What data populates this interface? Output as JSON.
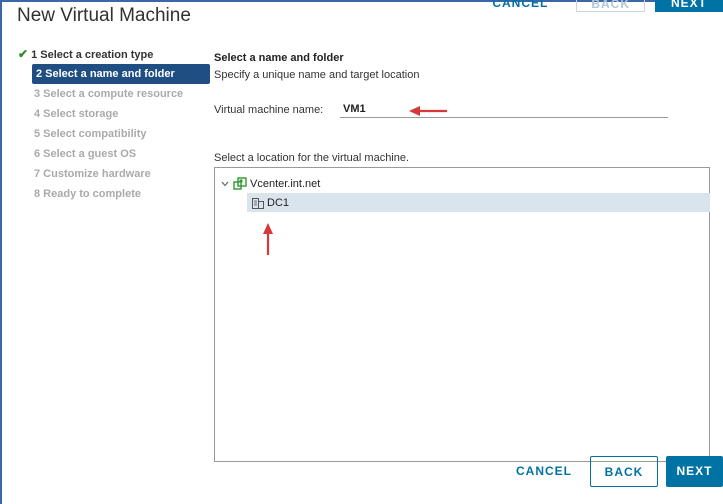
{
  "window": {
    "title": "New Virtual Machine"
  },
  "top_buttons": {
    "cancel": "CANCEL",
    "back": "BACK",
    "next": "NEXT"
  },
  "steps": [
    {
      "label": "1 Select a creation type",
      "state": "done"
    },
    {
      "label": "2 Select a name and folder",
      "state": "active"
    },
    {
      "label": "3 Select a compute resource",
      "state": "pending"
    },
    {
      "label": "4 Select storage",
      "state": "pending"
    },
    {
      "label": "5 Select compatibility",
      "state": "pending"
    },
    {
      "label": "6 Select a guest OS",
      "state": "pending"
    },
    {
      "label": "7 Customize hardware",
      "state": "pending"
    },
    {
      "label": "8 Ready to complete",
      "state": "pending"
    }
  ],
  "main": {
    "section_title": "Select a name and folder",
    "section_subtitle": "Specify a unique name and target location",
    "vm_name_label": "Virtual machine name:",
    "vm_name_value": "VM1",
    "location_label": "Select a location for the virtual machine.",
    "tree": {
      "root": {
        "label": "Vcenter.int.net",
        "icon": "vcenter-icon",
        "expanded": true
      },
      "child": {
        "label": "DC1",
        "icon": "datacenter-icon",
        "selected": true
      }
    }
  },
  "buttons": {
    "cancel": "CANCEL",
    "back": "BACK",
    "next": "NEXT"
  },
  "colors": {
    "accent": "#0072a3",
    "active_step_bg": "#1f4e83",
    "selected_row_bg": "#d9e4ec",
    "check": "#2e8b2e",
    "annotation_arrow": "#d9383a"
  }
}
